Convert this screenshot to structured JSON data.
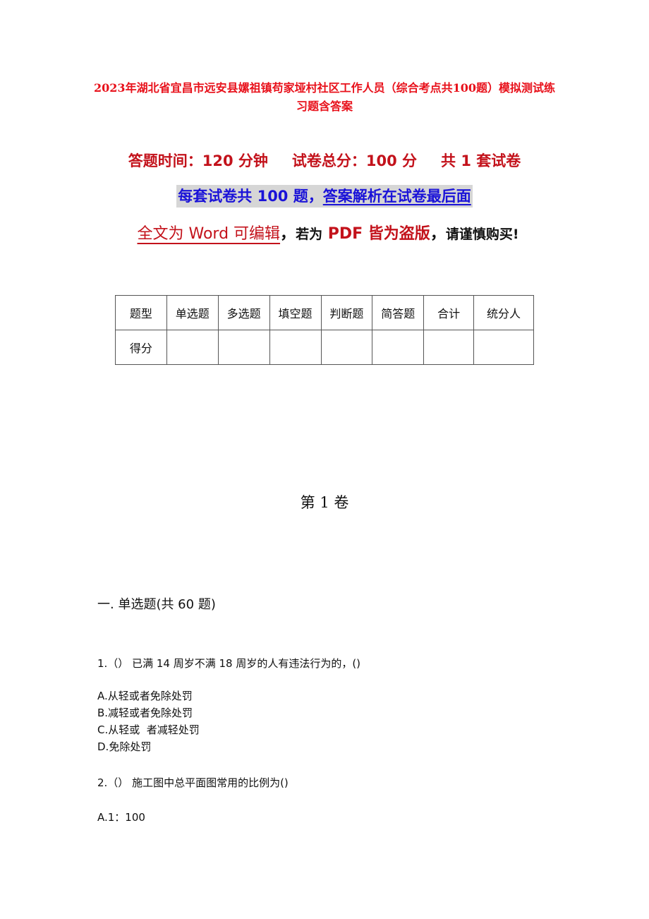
{
  "document": {
    "title": "2023年湖北省宜昌市远安县嫘祖镇苟家垭村社区工作人员（综合考点共100题）模拟测试练习题含答案",
    "exam_info": {
      "time": "答题时间：120 分钟",
      "total_score": "试卷总分：100 分",
      "sets": "共 1 套试卷"
    },
    "notice": {
      "part1": "每套试卷共 100 题，",
      "part2": "答案解析在试卷最后面"
    },
    "warning": {
      "editable": "全文为 Word 可编辑",
      "comma1": "，",
      "if_pdf": "若为",
      "pdf_piracy": " PDF 皆为盗版",
      "comma2": "，",
      "buy_carefully": "请谨慎购买!"
    },
    "score_table": {
      "header": [
        "题型",
        "单选题",
        "多选题",
        "填空题",
        "判断题",
        "简答题",
        "合计",
        "统分人"
      ],
      "row_label": "得分",
      "row_values": [
        "",
        "",
        "",
        "",
        "",
        "",
        ""
      ]
    },
    "volume_title": "第 1 卷",
    "section_title": "一. 单选题(共 60 题)",
    "questions": [
      {
        "stem": "1.（） 已满 14 周岁不满 18 周岁的人有违法行为的，()",
        "options": [
          "A.从轻或者免除处罚",
          "B.减轻或者免除处罚",
          "C.从轻或  者减轻处罚",
          "D.免除处罚"
        ]
      },
      {
        "stem": "2.（） 施工图中总平面图常用的比例为()",
        "options": [
          "A.1：100"
        ]
      }
    ]
  }
}
